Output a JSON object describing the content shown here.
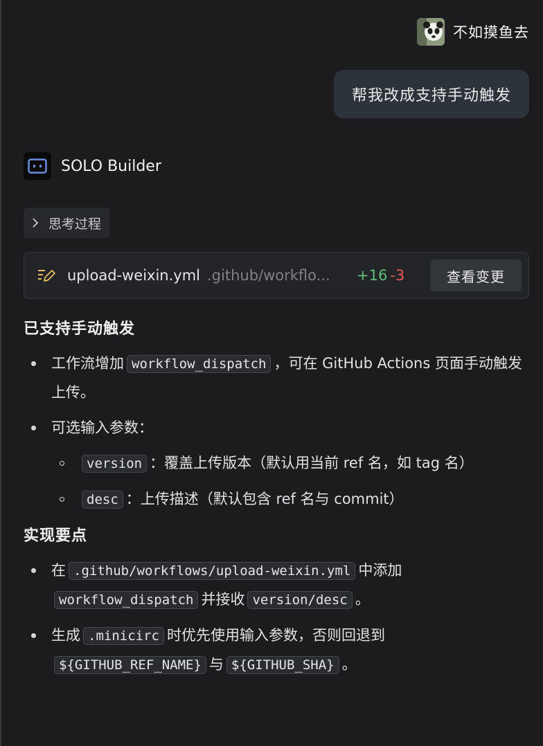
{
  "user": {
    "name": "不如摸鱼去",
    "avatar_icon": "panda-avatar"
  },
  "user_message": "帮我改成支持手动触发",
  "bot": {
    "name": "SOLO Builder",
    "logo_icon": "solo-builder-logo"
  },
  "thinking": {
    "label": "思考过程"
  },
  "file_change": {
    "file_name": "upload-weixin.yml",
    "path": ".github/workflo...",
    "additions": "+16",
    "deletions": "-3",
    "view_button": "查看变更"
  },
  "sections": {
    "s1_title": "已支持手动触发",
    "s1_item1_pre": "工作流增加",
    "s1_item1_code": "workflow_dispatch",
    "s1_item1_post": "，可在 GitHub Actions 页面手动触发上传。",
    "s1_item2": "可选输入参数：",
    "s1_sub1_code": "version",
    "s1_sub1_text": "：覆盖上传版本（默认用当前 ref 名，如 tag 名）",
    "s1_sub2_code": "desc",
    "s1_sub2_text": "：上传描述（默认包含 ref 名与 commit）",
    "s2_title": "实现要点",
    "s2_item1_pre": "在",
    "s2_item1_code1": ".github/workflows/upload-weixin.yml",
    "s2_item1_mid": "中添加",
    "s2_item1_code2": "workflow_dispatch",
    "s2_item1_mid2": "并接收",
    "s2_item1_code3": "version/desc",
    "s2_item1_post": "。",
    "s2_item2_pre": "生成",
    "s2_item2_code1": ".minicirc",
    "s2_item2_mid": "时优先使用输入参数，否则回退到",
    "s2_item2_code2": "${GITHUB_REF_NAME}",
    "s2_item2_mid2": "与",
    "s2_item2_code3": "${GITHUB_SHA}",
    "s2_item2_post": "。"
  }
}
